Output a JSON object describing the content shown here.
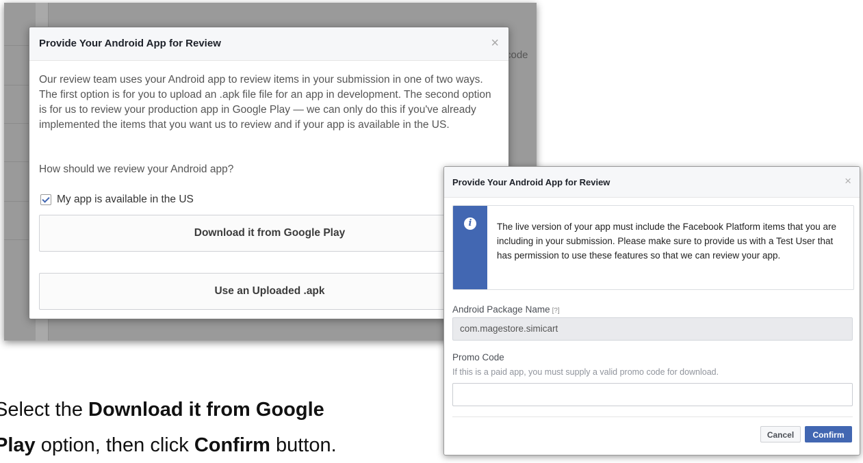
{
  "dialog_a": {
    "title": "Provide Your Android App for Review",
    "close_glyph": "×",
    "description": "Our review team uses your Android app to review items in your submission in one of two ways. The first option is for you to upload an .apk file file for an app in development. The second option is for us to review your production app in Google Play — we can only do this if you've already implemented the items that you want us to review and if your app is available in the US.",
    "question": "How should we review your Android app?",
    "checkbox_label": "My app is available in the US",
    "checkbox_checked": true,
    "option_google_play": "Download it from Google Play",
    "option_upload_apk": "Use an Uploaded .apk",
    "background_fragment": "code"
  },
  "dialog_b": {
    "title": "Provide Your Android App for Review",
    "close_glyph": "×",
    "info_message": "The live version of your app must include the Facebook Platform items that you are including in your submission. Please make sure to provide us with a Test User that has permission to use these features so that we can review your app.",
    "package_label": "Android Package Name",
    "package_help": "[?]",
    "package_value": "com.magestore.simicart",
    "promo_label": "Promo Code",
    "promo_help": "If this is a paid app, you must supply a valid promo code for download.",
    "promo_value": "",
    "cancel_label": "Cancel",
    "confirm_label": "Confirm",
    "accent_color": "#4267b2"
  },
  "caption": {
    "part1": "Select the ",
    "bold1": "Download it from Google",
    "bold1b": "Play",
    "part2": " option, then click ",
    "bold2": "Confirm",
    "part3": " button."
  }
}
